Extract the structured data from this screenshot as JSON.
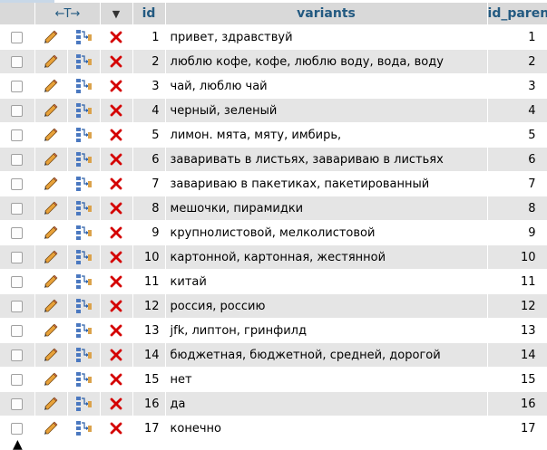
{
  "header": {
    "arrows_label": "←T→",
    "sort_toggle": "▼",
    "col_id": "id",
    "col_variants": "variants",
    "col_parent": "id_parent"
  },
  "icons": {
    "edit": "pencil-icon",
    "copy": "copy-icon",
    "delete": "delete-icon"
  },
  "colors": {
    "header_bg": "#d9d9d9",
    "header_text": "#235a81",
    "row_alt": "#e5e5e5",
    "delete_red": "#d40000"
  },
  "rows": [
    {
      "id": "1",
      "variants": "привет, здравствуй",
      "id_parent": "1"
    },
    {
      "id": "2",
      "variants": "люблю кофе, кофе, люблю воду, вода, воду",
      "id_parent": "2"
    },
    {
      "id": "3",
      "variants": "чай, люблю чай",
      "id_parent": "3"
    },
    {
      "id": "4",
      "variants": "черный, зеленый",
      "id_parent": "4"
    },
    {
      "id": "5",
      "variants": "лимон. мята, мяту, имбирь,",
      "id_parent": "5"
    },
    {
      "id": "6",
      "variants": "заваривать в листьях, завариваю в листьях",
      "id_parent": "6"
    },
    {
      "id": "7",
      "variants": "завариваю в пакетиках, пакетированный",
      "id_parent": "7"
    },
    {
      "id": "8",
      "variants": "мешочки, пирамидки",
      "id_parent": "8"
    },
    {
      "id": "9",
      "variants": "крупнолистовой, мелколистовой",
      "id_parent": "9"
    },
    {
      "id": "10",
      "variants": "картонной, картонная, жестянной",
      "id_parent": "10"
    },
    {
      "id": "11",
      "variants": "китай",
      "id_parent": "11"
    },
    {
      "id": "12",
      "variants": "россия, россию",
      "id_parent": "12"
    },
    {
      "id": "13",
      "variants": "jfk, липтон, гринфилд",
      "id_parent": "13"
    },
    {
      "id": "14",
      "variants": "бюджетная, бюджетной, средней, дорогой",
      "id_parent": "14"
    },
    {
      "id": "15",
      "variants": "нет",
      "id_parent": "15"
    },
    {
      "id": "16",
      "variants": "да",
      "id_parent": "16"
    },
    {
      "id": "17",
      "variants": "конечно",
      "id_parent": "17"
    }
  ]
}
